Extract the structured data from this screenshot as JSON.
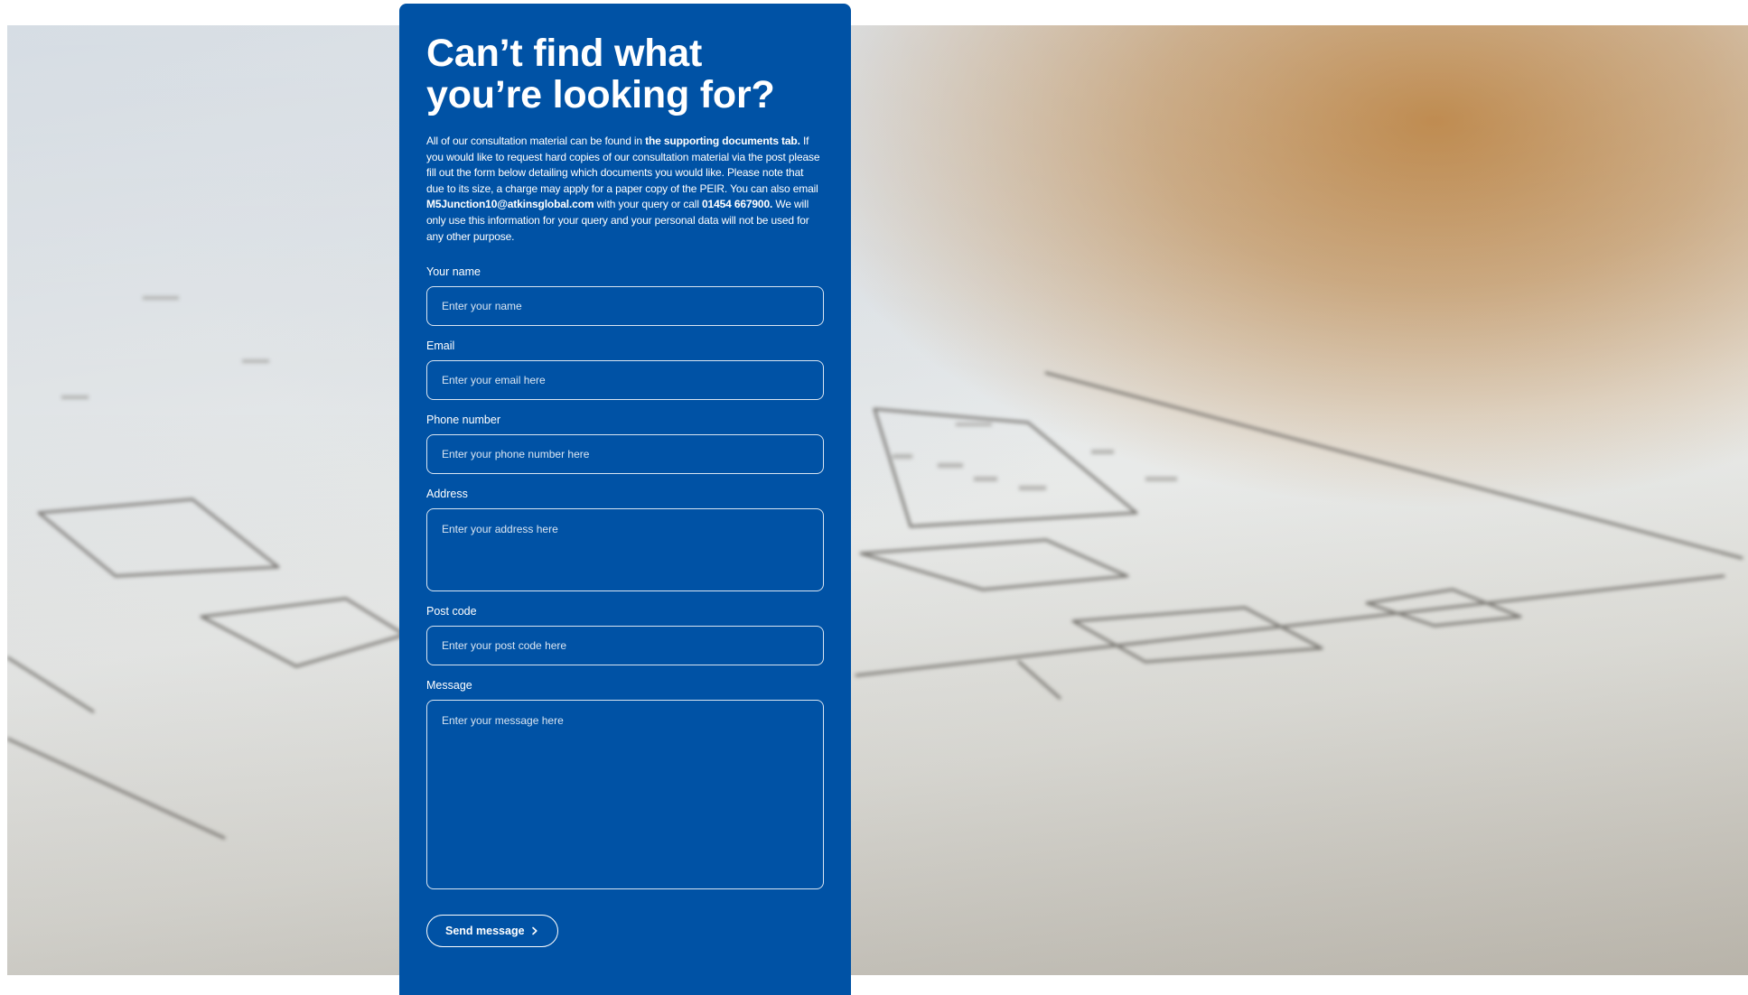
{
  "contact": {
    "title_line1": "Can’t find what",
    "title_line2": "you’re looking for?",
    "intro": {
      "t1": "All of our consultation material can be found in ",
      "link": "the supporting documents tab.",
      "t2": " If you would like to request hard copies of our consultation material via the post please fill out the form below detailing which documents you would like. Please note that due to its size, a charge may apply for a paper copy of the PEIR. You can also email ",
      "email": "M5Junction10@atkinsglobal.com",
      "t3": " with your query or call ",
      "phone": "01454 667900.",
      "t4": " We will only use this information for your query and your personal data will not be used for any other purpose."
    },
    "fields": {
      "name": {
        "label": "Your name",
        "placeholder": "Enter your name"
      },
      "email": {
        "label": "Email",
        "placeholder": "Enter your email here"
      },
      "phone": {
        "label": "Phone number",
        "placeholder": "Enter your phone number here"
      },
      "address": {
        "label": "Address",
        "placeholder": "Enter your address here"
      },
      "postcode": {
        "label": "Post code",
        "placeholder": "Enter your post code here"
      },
      "message": {
        "label": "Message",
        "placeholder": "Enter your message here"
      }
    },
    "send_label": "Send message",
    "send_icon": "chevron-right-icon"
  },
  "colors": {
    "panel_blue": "#0052a5",
    "text_white": "#ffffff"
  }
}
